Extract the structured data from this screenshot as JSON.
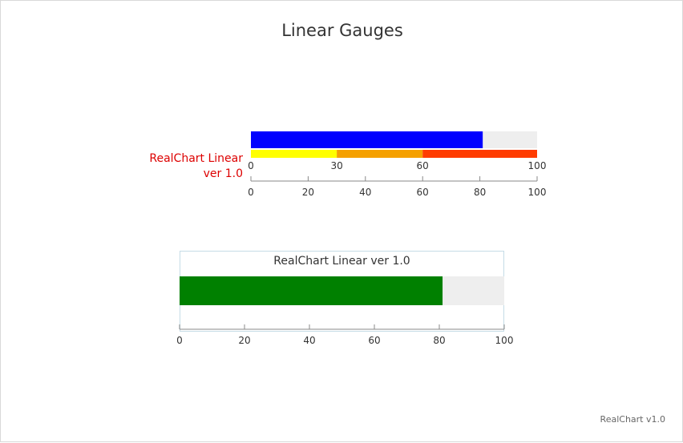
{
  "chart_data": {
    "type": "linear-gauge",
    "title": "Linear Gauges",
    "credits": "RealChart v1.0",
    "colors": {
      "background_band": "#eeeeee",
      "axis": "#888888",
      "text": "#333333"
    },
    "gauges": [
      {
        "label": [
          "RealChart Linear",
          "ver 1.0"
        ],
        "label_color": "#dd0000",
        "min": 0,
        "max": 100,
        "value": 81,
        "bar_color": "#0000ff",
        "bands": [
          {
            "from": 0,
            "to": 30,
            "color": "#ffff00"
          },
          {
            "from": 30,
            "to": 60,
            "color": "#f5a000"
          },
          {
            "from": 60,
            "to": 100,
            "color": "#ff3c00"
          }
        ],
        "band_ticks": [
          "0",
          "30",
          "60",
          "100"
        ],
        "axis_ticks": [
          "0",
          "20",
          "40",
          "60",
          "80",
          "100"
        ]
      },
      {
        "title": "RealChart Linear ver 1.0",
        "min": 0,
        "max": 100,
        "value": 81,
        "bar_color": "#008000",
        "border_color": "#c5dce6",
        "axis_ticks": [
          "0",
          "20",
          "40",
          "60",
          "80",
          "100"
        ]
      }
    ]
  }
}
